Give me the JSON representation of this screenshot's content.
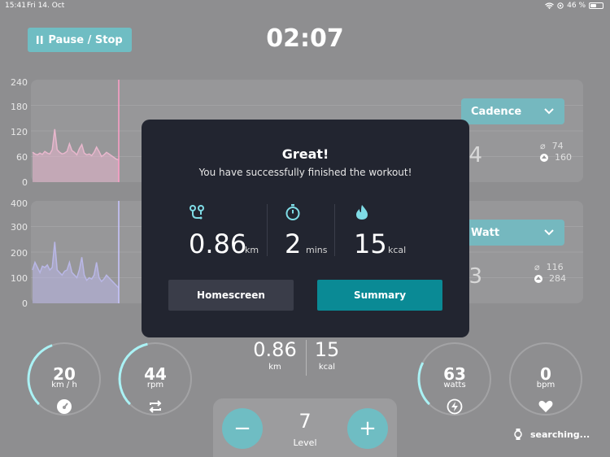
{
  "status_bar": {
    "time": "15:41",
    "date": "Fri 14. Oct",
    "battery": "46 %"
  },
  "header": {
    "pause_label": "Pause / Stop",
    "timer": "02:07"
  },
  "chart_data": [
    {
      "type": "area",
      "yticks": [
        "240",
        "180",
        "120",
        "60",
        "0"
      ],
      "ylim": [
        0,
        240
      ],
      "color": "#e8b7cd",
      "values": [
        70,
        66,
        64,
        68,
        65,
        72,
        68,
        66,
        76,
        124,
        76,
        70,
        66,
        68,
        72,
        90,
        74,
        70,
        64,
        78,
        88,
        68,
        64,
        66,
        62,
        70,
        82,
        72,
        60,
        64,
        70,
        66,
        62,
        58,
        54,
        52
      ]
    },
    {
      "type": "area",
      "yticks": [
        "400",
        "300",
        "200",
        "100",
        "0"
      ],
      "ylim": [
        0,
        400
      ],
      "color": "#b9b7e6",
      "values": [
        130,
        160,
        140,
        120,
        145,
        140,
        150,
        130,
        140,
        240,
        130,
        120,
        110,
        125,
        130,
        160,
        120,
        110,
        100,
        130,
        180,
        110,
        90,
        100,
        95,
        110,
        160,
        100,
        85,
        95,
        110,
        100,
        90,
        80,
        70,
        60
      ]
    }
  ],
  "panels": [
    {
      "dropdown": "Cadence",
      "value": "44",
      "avg": "74",
      "max": "160"
    },
    {
      "dropdown": "Watt",
      "value": "63",
      "avg": "116",
      "max": "284"
    }
  ],
  "gauges": [
    {
      "value": "20",
      "unit": "km / h",
      "icon": "speedometer-icon",
      "progress": 0.32
    },
    {
      "value": "44",
      "unit": "rpm",
      "icon": "repeat-icon",
      "progress": 0.34
    },
    {
      "value": "63",
      "unit": "watts",
      "icon": "lightning-icon",
      "progress": 0.2
    },
    {
      "value": "0",
      "unit": "bpm",
      "icon": "heart-icon",
      "progress": 0
    }
  ],
  "totals": {
    "distance": "0.86",
    "distance_unit": "km",
    "calories": "15",
    "calories_unit": "kcal"
  },
  "level": {
    "value": "7",
    "label": "Level",
    "minus": "−",
    "plus": "+"
  },
  "heart_sensor": {
    "status": "searching..."
  },
  "modal": {
    "title": "Great!",
    "subtitle": "You have successfully finished the workout!",
    "stats": [
      {
        "icon": "route-icon",
        "value": "0.86",
        "unit": "km"
      },
      {
        "icon": "stopwatch-icon",
        "value": "2",
        "unit": "mins"
      },
      {
        "icon": "flame-icon",
        "value": "15",
        "unit": "kcal"
      }
    ],
    "home_button": "Homescreen",
    "summary_button": "Summary"
  },
  "colors": {
    "accent": "#6fbdc3",
    "modal_bg": "#222530",
    "summary_btn": "#0a8a95",
    "cursor_line": "#ff9fc8"
  }
}
